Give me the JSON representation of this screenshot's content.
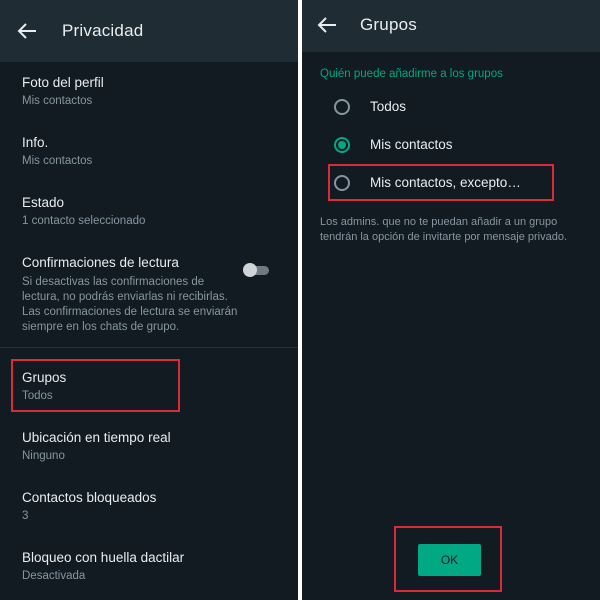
{
  "left": {
    "title": "Privacidad",
    "items": [
      {
        "title": "Foto del perfil",
        "subtitle": "Mis contactos"
      },
      {
        "title": "Info.",
        "subtitle": "Mis contactos"
      },
      {
        "title": "Estado",
        "subtitle": "1 contacto seleccionado"
      },
      {
        "title": "Confirmaciones de lectura",
        "description": "Si desactivas las confirmaciones de lectura, no podrás enviarlas ni recibirlas. Las confirmaciones de lectura se enviarán siempre en los chats de grupo.",
        "toggle": false
      },
      {
        "title": "Grupos",
        "subtitle": "Todos"
      },
      {
        "title": "Ubicación en tiempo real",
        "subtitle": "Ninguno"
      },
      {
        "title": "Contactos bloqueados",
        "subtitle": "3"
      },
      {
        "title": "Bloqueo con huella dactilar",
        "subtitle": "Desactivada"
      }
    ]
  },
  "right": {
    "title": "Grupos",
    "section_header": "Quién puede añadirme a los grupos",
    "options": [
      {
        "label": "Todos",
        "checked": false
      },
      {
        "label": "Mis contactos",
        "checked": true
      },
      {
        "label": "Mis contactos, excepto…",
        "checked": false
      }
    ],
    "note": "Los admins. que no te puedan añadir a un grupo tendrán la opción de invitarte por mensaje privado.",
    "ok_label": "OK"
  },
  "colors": {
    "background": "#121b22",
    "appbar": "#1f2c34",
    "accent": "#00a884",
    "primary_text": "#e9edef",
    "secondary_text": "#8696a0",
    "highlight": "#d92b3a"
  },
  "icons": {
    "back": "arrow-left-icon"
  }
}
